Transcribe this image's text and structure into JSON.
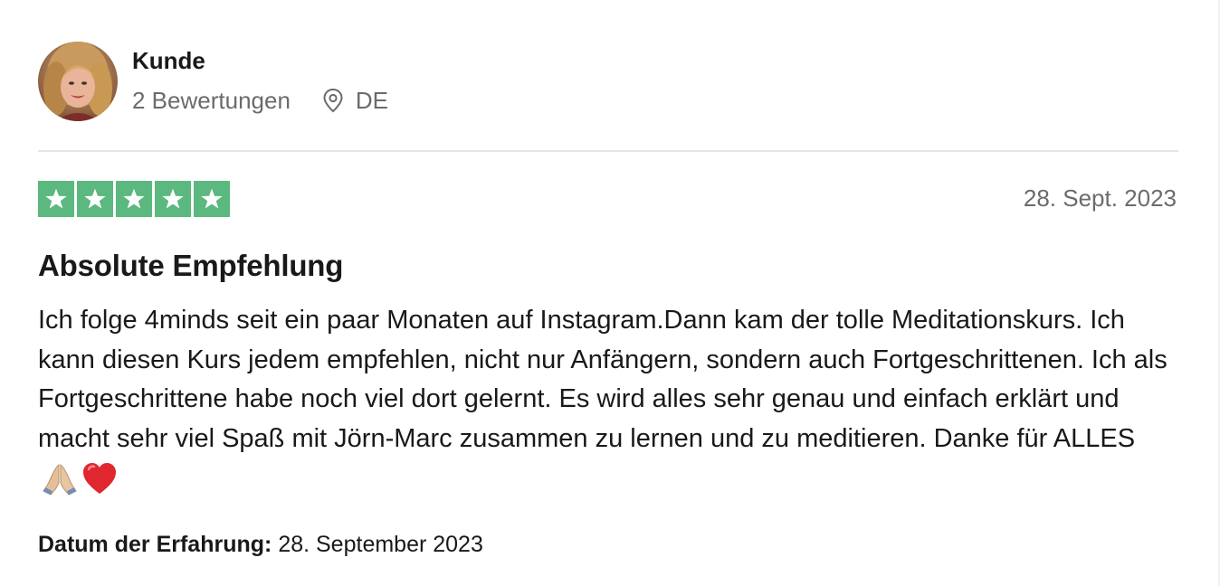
{
  "consumer": {
    "name": "Kunde",
    "reviews_count": "2 Bewertungen",
    "country": "DE"
  },
  "review": {
    "rating": 5,
    "rating_max": 5,
    "date": "28. Sept. 2023",
    "title": "Absolute Empfehlung",
    "body": "Ich folge 4minds seit ein paar Monaten auf Instagram.Dann kam der tolle Meditationskurs. Ich kann diesen Kurs jedem empfehlen, nicht nur Anfängern, sondern auch Fortgeschrittenen. Ich als Fortgeschrittene habe noch viel dort gelernt. Es wird alles sehr genau und einfach erklärt und macht sehr viel Spaß mit Jörn-Marc zusammen zu lernen und zu meditieren. Danke für ALLES",
    "experience_label": "Datum der Erfahrung:",
    "experience_date": "28. September 2023"
  },
  "colors": {
    "star_green": "#5bb87f",
    "text": "#191919",
    "muted": "#6b6b6b",
    "divider": "#e5e5e5"
  },
  "icons": {
    "location": "map-pin-icon",
    "star": "star-icon",
    "emoji": [
      "folded-hands-emoji",
      "red-heart-emoji"
    ]
  }
}
